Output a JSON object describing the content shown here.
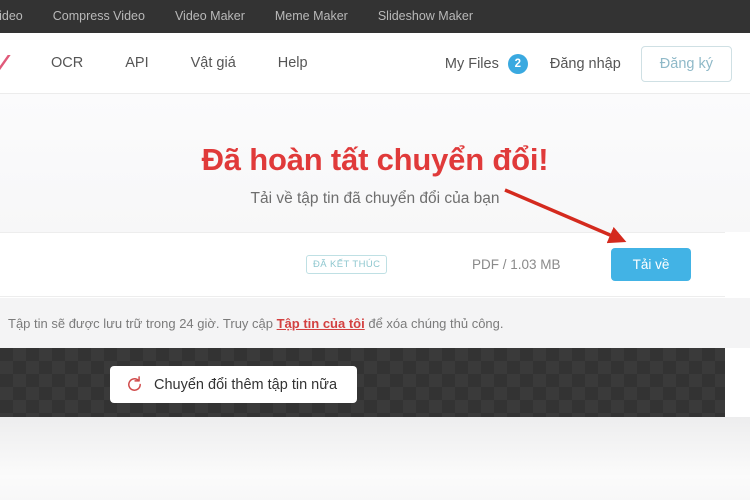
{
  "topbar": {
    "items": [
      {
        "label": "Video"
      },
      {
        "label": "Compress Video"
      },
      {
        "label": "Video Maker"
      },
      {
        "label": "Meme Maker"
      },
      {
        "label": "Slideshow Maker"
      }
    ]
  },
  "mainnav": {
    "logo_icon": "checkmark-logo-fragment",
    "links": [
      {
        "label": "OCR"
      },
      {
        "label": "API"
      },
      {
        "label": "Vật giá"
      },
      {
        "label": "Help"
      }
    ],
    "my_files_label": "My Files",
    "my_files_count": "2",
    "login_label": "Đăng nhập",
    "signup_label": "Đăng ký"
  },
  "hero": {
    "title": "Đã hoàn tất chuyển đổi!",
    "subtitle": "Tải về tập tin đã chuyển đổi của bạn"
  },
  "file_row": {
    "status_label": "ĐÃ KẾT THÚC",
    "file_meta": "PDF / 1.03 MB",
    "download_label": "Tải về"
  },
  "notice": {
    "text_before": "Tập tin sẽ được lưu trữ trong 24 giờ. Truy cập ",
    "link_label": "Tập tin của tôi",
    "text_after": " để xóa chúng thủ công."
  },
  "footer": {
    "convert_more_label": "Chuyển đổi thêm tập tin nữa",
    "refresh_icon": "refresh-icon"
  },
  "annotation": {
    "arrow_icon": "red-arrow-pointing-to-download-button",
    "arrow_color": "#d42a1e"
  },
  "colors": {
    "accent_blue": "#42b3e5",
    "heading_red": "#e03a3a",
    "badge_blue": "#3aa9e0",
    "status_teal": "#8ec7cf",
    "dark_bar": "#333333"
  }
}
